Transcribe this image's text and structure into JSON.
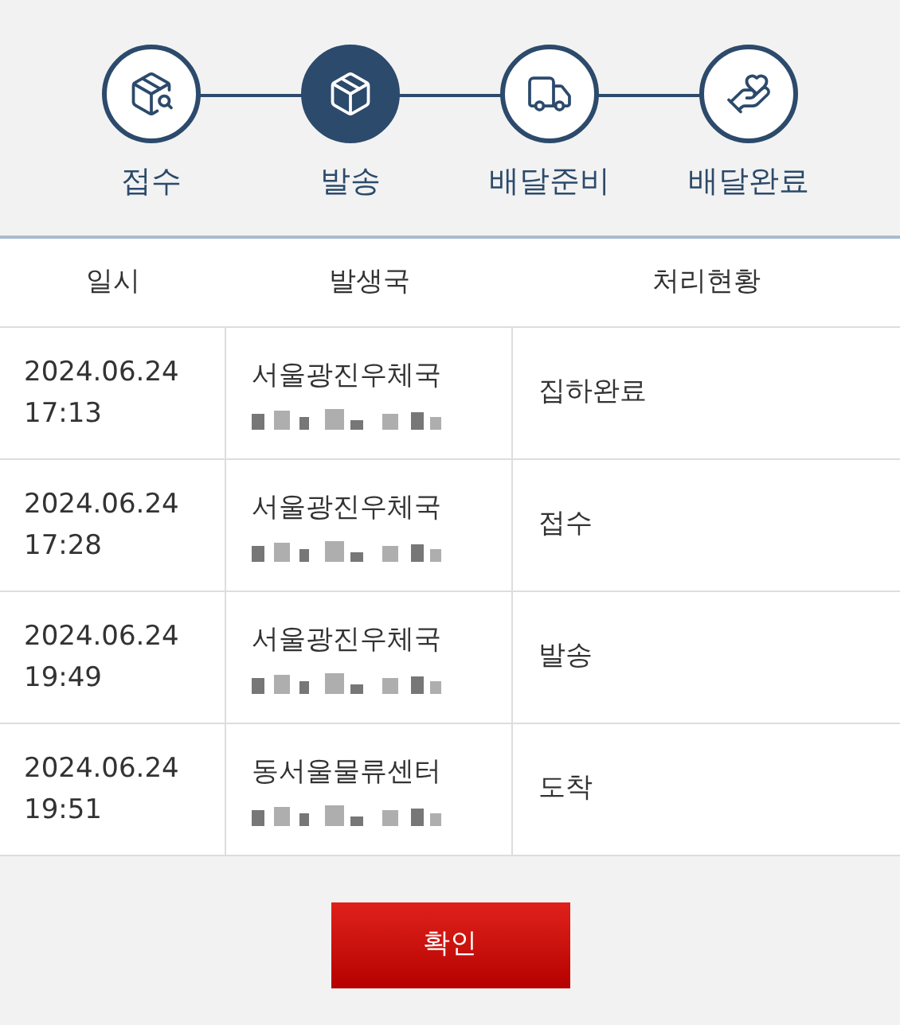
{
  "steps": [
    {
      "label": "접수",
      "selected": false,
      "kind": "receive"
    },
    {
      "label": "발송",
      "selected": true,
      "kind": "ship"
    },
    {
      "label": "배달준비",
      "selected": false,
      "kind": "truck"
    },
    {
      "label": "배달완료",
      "selected": false,
      "kind": "deliver"
    }
  ],
  "table": {
    "columns": [
      "일시",
      "발생국",
      "처리현황"
    ],
    "rows": [
      {
        "date": "2024.06.24",
        "time": "17:13",
        "office": "서울광진우체국",
        "status": "집하완료"
      },
      {
        "date": "2024.06.24",
        "time": "17:28",
        "office": "서울광진우체국",
        "status": "접수"
      },
      {
        "date": "2024.06.24",
        "time": "19:49",
        "office": "서울광진우체국",
        "status": "발송"
      },
      {
        "date": "2024.06.24",
        "time": "19:51",
        "office": "동서울물류센터",
        "status": "도착"
      }
    ]
  },
  "confirm_button": "확인"
}
